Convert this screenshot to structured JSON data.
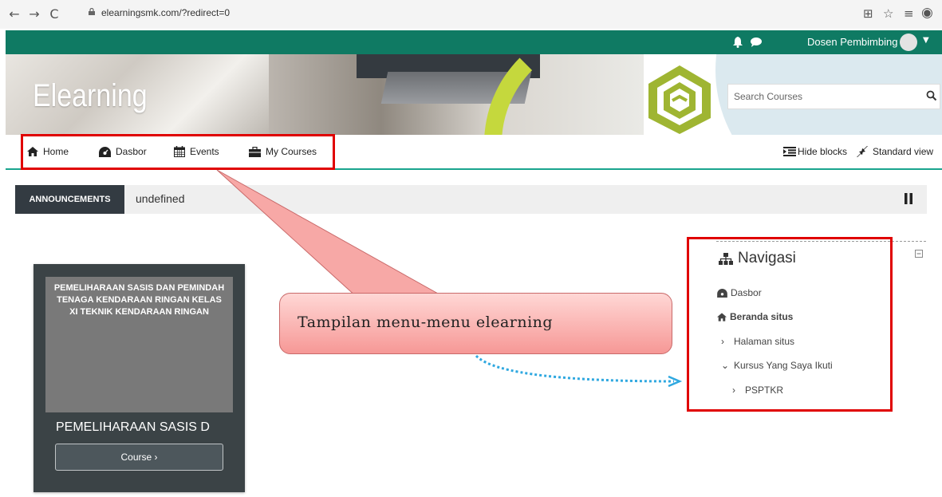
{
  "browser": {
    "url": "elearningsmk.com/?redirect=0",
    "nav_back": "←",
    "nav_forward": "→",
    "nav_reload": "C"
  },
  "topbar": {
    "username": "Dosen Pembimbing"
  },
  "header": {
    "site_title": "Elearning",
    "search_placeholder": "Search Courses"
  },
  "mainnav": {
    "items": [
      {
        "label": "Home",
        "icon": "home-icon"
      },
      {
        "label": "Dasbor",
        "icon": "dashboard-icon"
      },
      {
        "label": "Events",
        "icon": "calendar-icon"
      },
      {
        "label": "My Courses",
        "icon": "briefcase-icon"
      }
    ],
    "hide_blocks": "Hide blocks",
    "standard_view": "Standard view"
  },
  "announcements": {
    "label": "ANNOUNCEMENTS",
    "text": "undefined"
  },
  "course_card": {
    "image_text": "PEMELIHARAAN SASIS DAN PEMINDAH TENAGA KENDARAAN RINGAN KELAS XI TEKNIK KENDARAAN RINGAN",
    "title": "PEMELIHARAAN SASIS D",
    "button": "Course ›"
  },
  "navigation_block": {
    "title": "Navigasi",
    "items": [
      {
        "label": "Dasbor",
        "prefix": "",
        "bold": false
      },
      {
        "label": "Beranda situs",
        "prefix": "",
        "bold": true
      },
      {
        "label": "Halaman situs",
        "prefix": "›",
        "bold": false
      },
      {
        "label": "Kursus Yang Saya Ikuti",
        "prefix": "⌄",
        "bold": false
      },
      {
        "label": "PSPTKR",
        "prefix": "›",
        "bold": false
      }
    ]
  },
  "annotation": {
    "callout_text": "Tampilan menu-menu elearning"
  },
  "colors": {
    "topbar": "#0f7a63",
    "nav_underline": "#1aa48e",
    "annotation_red": "#e00000",
    "callout_pink": "#f69896",
    "arrow_blue": "#2fa8e0"
  }
}
